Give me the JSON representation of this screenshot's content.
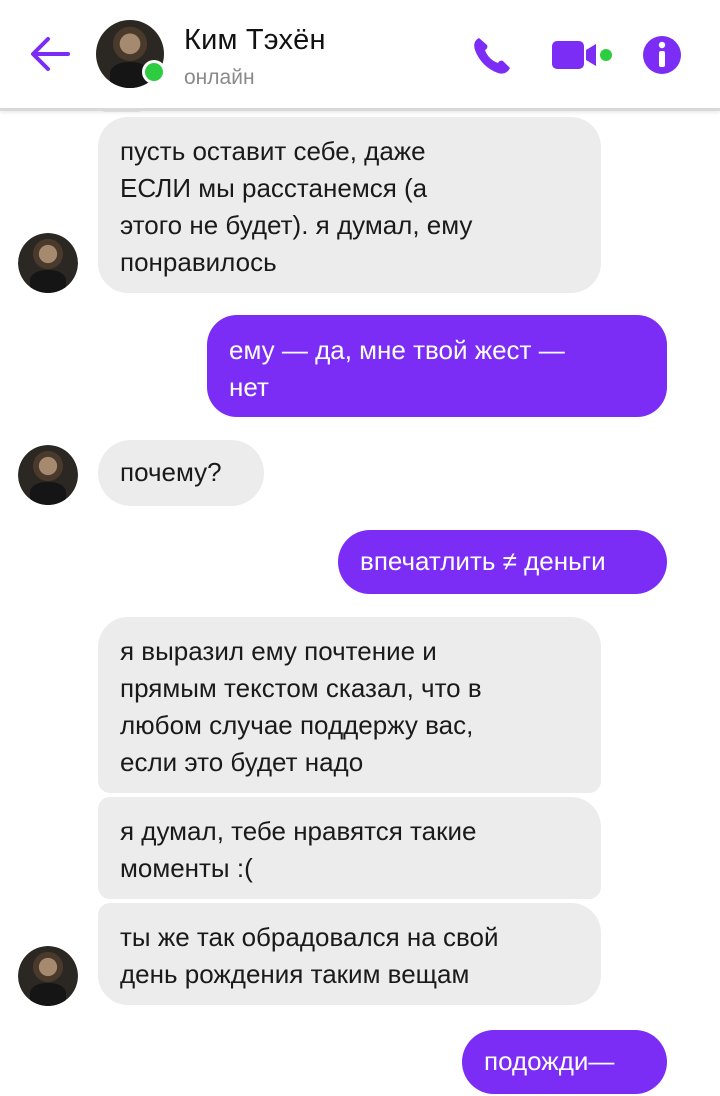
{
  "header": {
    "contact_name": "Ким Тэхён",
    "status": "онлайн",
    "colors": {
      "accent": "#7b2cf5",
      "online": "#2ecc40"
    },
    "icons": [
      "back-arrow-icon",
      "phone-icon",
      "video-camera-icon",
      "info-icon"
    ]
  },
  "messages": [
    {
      "direction": "in",
      "text": "пусть оставит себе, даже\nЕСЛИ мы расстанемся (а\nэтого не будет). я думал, ему\nпонравилось"
    },
    {
      "direction": "out",
      "text": "ему — да, мне твой жест —\nнет"
    },
    {
      "direction": "in",
      "text": "почему?"
    },
    {
      "direction": "out",
      "text": "впечатлить ≠ деньги"
    },
    {
      "direction": "in",
      "text": "я выразил ему почтение и\nпрямым текстом сказал, что в\nлюбом случае поддержу вас,\nесли это будет надо"
    },
    {
      "direction": "in",
      "text": "я думал, тебе нравятся такие\nмоменты :("
    },
    {
      "direction": "in",
      "text": "ты же так обрадовался на свой\nдень рождения таким вещам"
    },
    {
      "direction": "out",
      "text": "подожди—"
    }
  ]
}
